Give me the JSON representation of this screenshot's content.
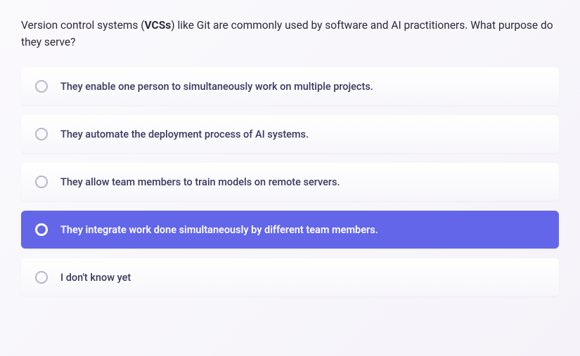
{
  "question": {
    "prefix": "Version control systems (",
    "bold": "VCSs",
    "suffix": ") like Git are commonly used by software and AI practitioners. What purpose do they serve?"
  },
  "options": [
    {
      "label": "They enable one person to simultaneously work on multiple projects.",
      "selected": false
    },
    {
      "label": "They automate the deployment process of AI systems.",
      "selected": false
    },
    {
      "label": "They allow team members to train models on remote servers.",
      "selected": false
    },
    {
      "label": "They integrate work done simultaneously by different team members.",
      "selected": true
    },
    {
      "label": "I don't know yet",
      "selected": false
    }
  ]
}
